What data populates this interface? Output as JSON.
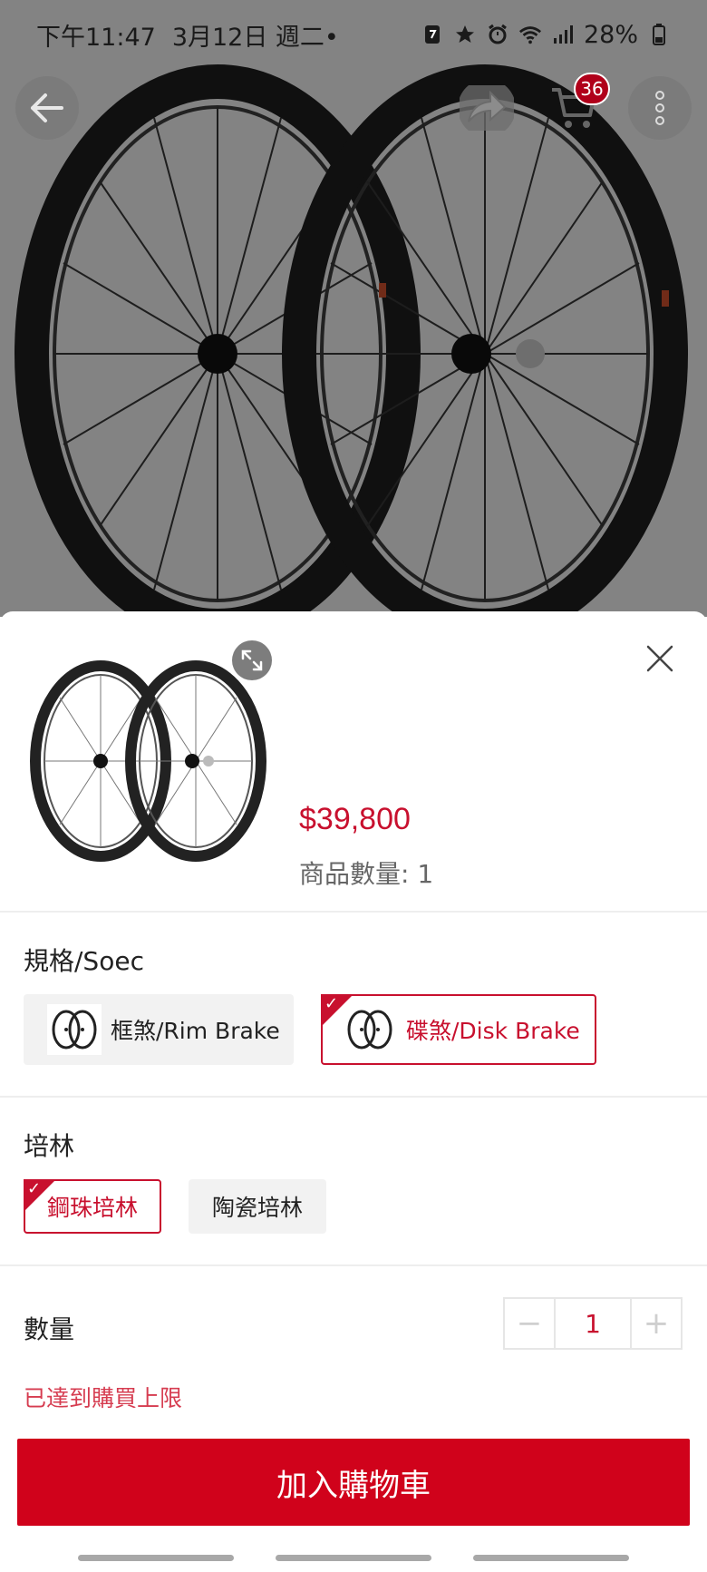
{
  "status_bar": {
    "time": "下午11:47",
    "date": "3月12日 週二•",
    "battery": "28%"
  },
  "header": {
    "cart_count": "36"
  },
  "product": {
    "price": "$39,800",
    "quantity_label": "商品數量: 1"
  },
  "spec": {
    "title": "規格/Soec",
    "options": [
      {
        "label": "框煞/Rim Brake",
        "selected": false
      },
      {
        "label": "碟煞/Disk Brake",
        "selected": true
      }
    ]
  },
  "bearing": {
    "title": "培林",
    "options": [
      {
        "label": "鋼珠培林",
        "selected": true
      },
      {
        "label": "陶瓷培林",
        "selected": false
      }
    ]
  },
  "quantity": {
    "title": "數量",
    "value": "1",
    "minus": "−",
    "plus": "+",
    "limit_message": "已達到購買上限"
  },
  "add_to_cart_label": "加入購物車",
  "colors": {
    "accent": "#c8102e",
    "button": "#d0021b"
  }
}
